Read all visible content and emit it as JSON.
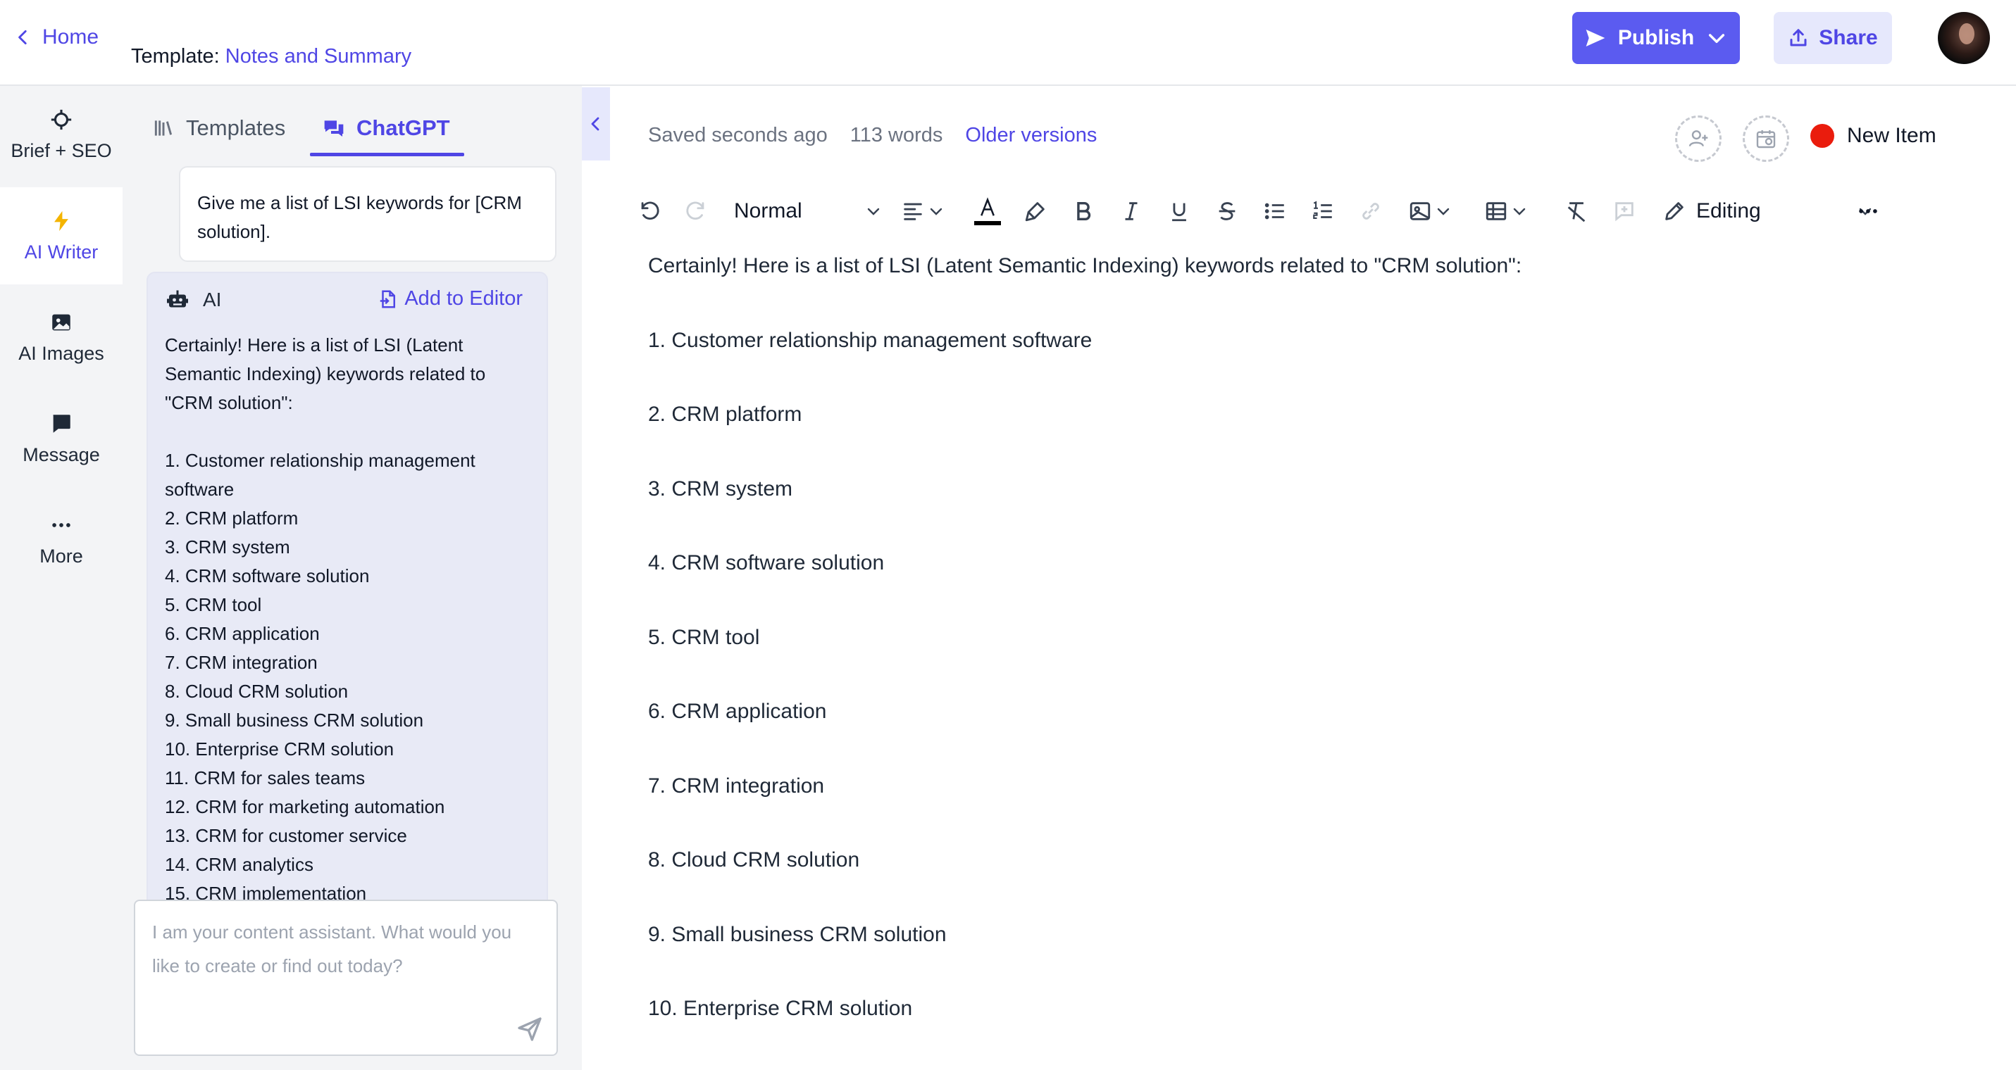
{
  "header": {
    "home_label": "Home",
    "template_prefix": "Template:",
    "template_name": "Notes and Summary",
    "publish_label": "Publish",
    "share_label": "Share"
  },
  "rail": {
    "items": [
      {
        "label": "Brief + SEO",
        "icon": "crosshair-icon"
      },
      {
        "label": "AI Writer",
        "icon": "lightning-icon",
        "active": true
      },
      {
        "label": "AI Images",
        "icon": "image-icon"
      },
      {
        "label": "Message",
        "icon": "chat-bubble-icon"
      },
      {
        "label": "More",
        "icon": "more-dots-icon"
      }
    ]
  },
  "chat": {
    "tabs": [
      {
        "label": "Templates",
        "icon": "library-icon"
      },
      {
        "label": "ChatGPT",
        "icon": "chat-icon",
        "active": true
      }
    ],
    "user_message": "Give me a list of LSI keywords for [CRM solution].",
    "ai_label": "AI",
    "add_to_editor": "Add to Editor",
    "ai_intro": "Certainly! Here is a list of LSI (Latent Semantic Indexing) keywords related to \"CRM solution\":",
    "ai_items": [
      "1. Customer relationship management software",
      "2. CRM platform",
      "3. CRM system",
      "4. CRM software solution",
      "5. CRM tool",
      "6. CRM application",
      "7. CRM integration",
      "8. Cloud CRM solution",
      "9. Small business CRM solution",
      "10. Enterprise CRM solution",
      "11. CRM for sales teams",
      "12. CRM for marketing automation",
      "13. CRM for customer service",
      "14. CRM analytics",
      "15. CRM implementation"
    ],
    "composer_placeholder": "I am your content assistant. What would you like to create or find out today?"
  },
  "editor": {
    "saved_status": "Saved seconds ago",
    "word_count": "113 words",
    "older_versions": "Older versions",
    "status_label": "New Item",
    "status_color": "#ea1c0d",
    "text_style": "Normal",
    "mode": "Editing",
    "paragraphs": [
      "Certainly! Here is a list of LSI (Latent Semantic Indexing) keywords related to \"CRM solution\":",
      "1. Customer relationship management software",
      "2. CRM platform",
      "3. CRM system",
      "4. CRM software solution",
      "5. CRM tool",
      "6. CRM application",
      "7. CRM integration",
      "8. Cloud CRM solution",
      "9. Small business CRM solution",
      "10. Enterprise CRM solution"
    ]
  },
  "colors": {
    "accent": "#4f46e5",
    "publish_bg": "#5b5bf0",
    "share_bg": "#e6e8fc"
  }
}
